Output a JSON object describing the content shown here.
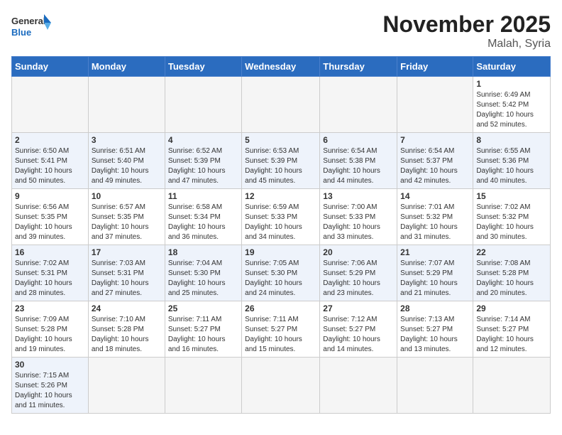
{
  "logo": {
    "text_general": "General",
    "text_blue": "Blue"
  },
  "title": "November 2025",
  "location": "Malah, Syria",
  "days_of_week": [
    "Sunday",
    "Monday",
    "Tuesday",
    "Wednesday",
    "Thursday",
    "Friday",
    "Saturday"
  ],
  "weeks": [
    [
      {
        "day": "",
        "info": ""
      },
      {
        "day": "",
        "info": ""
      },
      {
        "day": "",
        "info": ""
      },
      {
        "day": "",
        "info": ""
      },
      {
        "day": "",
        "info": ""
      },
      {
        "day": "",
        "info": ""
      },
      {
        "day": "1",
        "info": "Sunrise: 6:49 AM\nSunset: 5:42 PM\nDaylight: 10 hours\nand 52 minutes."
      }
    ],
    [
      {
        "day": "2",
        "info": "Sunrise: 6:50 AM\nSunset: 5:41 PM\nDaylight: 10 hours\nand 50 minutes."
      },
      {
        "day": "3",
        "info": "Sunrise: 6:51 AM\nSunset: 5:40 PM\nDaylight: 10 hours\nand 49 minutes."
      },
      {
        "day": "4",
        "info": "Sunrise: 6:52 AM\nSunset: 5:39 PM\nDaylight: 10 hours\nand 47 minutes."
      },
      {
        "day": "5",
        "info": "Sunrise: 6:53 AM\nSunset: 5:39 PM\nDaylight: 10 hours\nand 45 minutes."
      },
      {
        "day": "6",
        "info": "Sunrise: 6:54 AM\nSunset: 5:38 PM\nDaylight: 10 hours\nand 44 minutes."
      },
      {
        "day": "7",
        "info": "Sunrise: 6:54 AM\nSunset: 5:37 PM\nDaylight: 10 hours\nand 42 minutes."
      },
      {
        "day": "8",
        "info": "Sunrise: 6:55 AM\nSunset: 5:36 PM\nDaylight: 10 hours\nand 40 minutes."
      }
    ],
    [
      {
        "day": "9",
        "info": "Sunrise: 6:56 AM\nSunset: 5:35 PM\nDaylight: 10 hours\nand 39 minutes."
      },
      {
        "day": "10",
        "info": "Sunrise: 6:57 AM\nSunset: 5:35 PM\nDaylight: 10 hours\nand 37 minutes."
      },
      {
        "day": "11",
        "info": "Sunrise: 6:58 AM\nSunset: 5:34 PM\nDaylight: 10 hours\nand 36 minutes."
      },
      {
        "day": "12",
        "info": "Sunrise: 6:59 AM\nSunset: 5:33 PM\nDaylight: 10 hours\nand 34 minutes."
      },
      {
        "day": "13",
        "info": "Sunrise: 7:00 AM\nSunset: 5:33 PM\nDaylight: 10 hours\nand 33 minutes."
      },
      {
        "day": "14",
        "info": "Sunrise: 7:01 AM\nSunset: 5:32 PM\nDaylight: 10 hours\nand 31 minutes."
      },
      {
        "day": "15",
        "info": "Sunrise: 7:02 AM\nSunset: 5:32 PM\nDaylight: 10 hours\nand 30 minutes."
      }
    ],
    [
      {
        "day": "16",
        "info": "Sunrise: 7:02 AM\nSunset: 5:31 PM\nDaylight: 10 hours\nand 28 minutes."
      },
      {
        "day": "17",
        "info": "Sunrise: 7:03 AM\nSunset: 5:31 PM\nDaylight: 10 hours\nand 27 minutes."
      },
      {
        "day": "18",
        "info": "Sunrise: 7:04 AM\nSunset: 5:30 PM\nDaylight: 10 hours\nand 25 minutes."
      },
      {
        "day": "19",
        "info": "Sunrise: 7:05 AM\nSunset: 5:30 PM\nDaylight: 10 hours\nand 24 minutes."
      },
      {
        "day": "20",
        "info": "Sunrise: 7:06 AM\nSunset: 5:29 PM\nDaylight: 10 hours\nand 23 minutes."
      },
      {
        "day": "21",
        "info": "Sunrise: 7:07 AM\nSunset: 5:29 PM\nDaylight: 10 hours\nand 21 minutes."
      },
      {
        "day": "22",
        "info": "Sunrise: 7:08 AM\nSunset: 5:28 PM\nDaylight: 10 hours\nand 20 minutes."
      }
    ],
    [
      {
        "day": "23",
        "info": "Sunrise: 7:09 AM\nSunset: 5:28 PM\nDaylight: 10 hours\nand 19 minutes."
      },
      {
        "day": "24",
        "info": "Sunrise: 7:10 AM\nSunset: 5:28 PM\nDaylight: 10 hours\nand 18 minutes."
      },
      {
        "day": "25",
        "info": "Sunrise: 7:11 AM\nSunset: 5:27 PM\nDaylight: 10 hours\nand 16 minutes."
      },
      {
        "day": "26",
        "info": "Sunrise: 7:11 AM\nSunset: 5:27 PM\nDaylight: 10 hours\nand 15 minutes."
      },
      {
        "day": "27",
        "info": "Sunrise: 7:12 AM\nSunset: 5:27 PM\nDaylight: 10 hours\nand 14 minutes."
      },
      {
        "day": "28",
        "info": "Sunrise: 7:13 AM\nSunset: 5:27 PM\nDaylight: 10 hours\nand 13 minutes."
      },
      {
        "day": "29",
        "info": "Sunrise: 7:14 AM\nSunset: 5:27 PM\nDaylight: 10 hours\nand 12 minutes."
      }
    ],
    [
      {
        "day": "30",
        "info": "Sunrise: 7:15 AM\nSunset: 5:26 PM\nDaylight: 10 hours\nand 11 minutes."
      },
      {
        "day": "",
        "info": ""
      },
      {
        "day": "",
        "info": ""
      },
      {
        "day": "",
        "info": ""
      },
      {
        "day": "",
        "info": ""
      },
      {
        "day": "",
        "info": ""
      },
      {
        "day": "",
        "info": ""
      }
    ]
  ]
}
